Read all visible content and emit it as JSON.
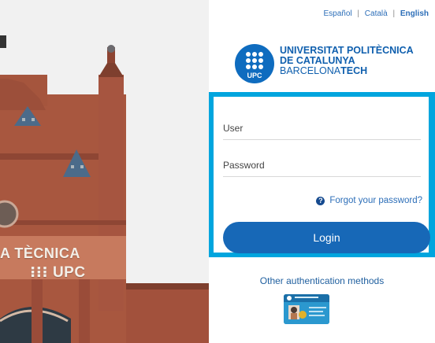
{
  "photo": {
    "facade_line1": "A TÈCNICA",
    "facade_line2": "UPC"
  },
  "languages": [
    {
      "label": "Español",
      "active": false
    },
    {
      "label": "Català",
      "active": false
    },
    {
      "label": "English",
      "active": true
    }
  ],
  "language_separator": "|",
  "logo": {
    "badge_text": "UPC",
    "line1": "UNIVERSITAT POLITÈCNICA",
    "line2": "DE CATALUNYA",
    "line3_normal": "BARCELONA",
    "line3_bold": "TECH"
  },
  "form": {
    "user_label": "User",
    "password_label": "Password",
    "forgot_label": "Forgot your password?",
    "login_label": "Login"
  },
  "other_methods_label": "Other authentication methods",
  "colors": {
    "accent_border": "#00a5de",
    "button": "#1768b7",
    "link": "#2c6eb8"
  }
}
